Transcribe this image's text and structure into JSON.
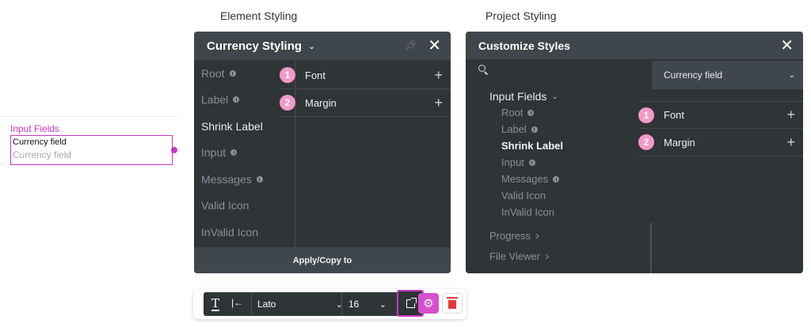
{
  "headings": {
    "element_styling": "Element Styling",
    "project_styling": "Project Styling"
  },
  "canvas_field": {
    "label": "Input Fields",
    "value": "Currency field",
    "placeholder": "Currency field"
  },
  "element_panel": {
    "title": "Currency Styling",
    "nav": [
      {
        "label": "Root",
        "info": true,
        "active": false
      },
      {
        "label": "Label",
        "info": true,
        "active": false
      },
      {
        "label": "Shrink Label",
        "info": false,
        "active": true
      },
      {
        "label": "Input",
        "info": true,
        "active": false
      },
      {
        "label": "Messages",
        "info": true,
        "active": false
      },
      {
        "label": "Valid Icon",
        "info": false,
        "active": false
      },
      {
        "label": "InValid Icon",
        "info": false,
        "active": false
      }
    ],
    "props": [
      {
        "num": "1",
        "label": "Font"
      },
      {
        "num": "2",
        "label": "Margin"
      }
    ],
    "apply_label": "Apply/Copy to"
  },
  "project_panel": {
    "title": "Customize Styles",
    "select_value": "Currency field",
    "tree_group": "Input Fields",
    "tree_items": [
      {
        "label": "Root",
        "info": true,
        "active": false
      },
      {
        "label": "Label",
        "info": true,
        "active": false
      },
      {
        "label": "Shrink Label",
        "info": false,
        "active": true
      },
      {
        "label": "Input",
        "info": true,
        "active": false
      },
      {
        "label": "Messages",
        "info": true,
        "active": false
      },
      {
        "label": "Valid Icon",
        "info": false,
        "active": false
      },
      {
        "label": "InValid Icon",
        "info": false,
        "active": false
      }
    ],
    "tree_more": [
      {
        "label": "Progress"
      },
      {
        "label": "File Viewer"
      }
    ],
    "props": [
      {
        "num": "1",
        "label": "Font"
      },
      {
        "num": "2",
        "label": "Margin"
      }
    ]
  },
  "toolbar": {
    "font": "Lato",
    "size": "16"
  },
  "colors": {
    "accent": "#c936c4",
    "panel_bg": "#2f3437",
    "panel_header": "#3f474c",
    "badge": "#f19ac8",
    "delete": "#e53935"
  }
}
